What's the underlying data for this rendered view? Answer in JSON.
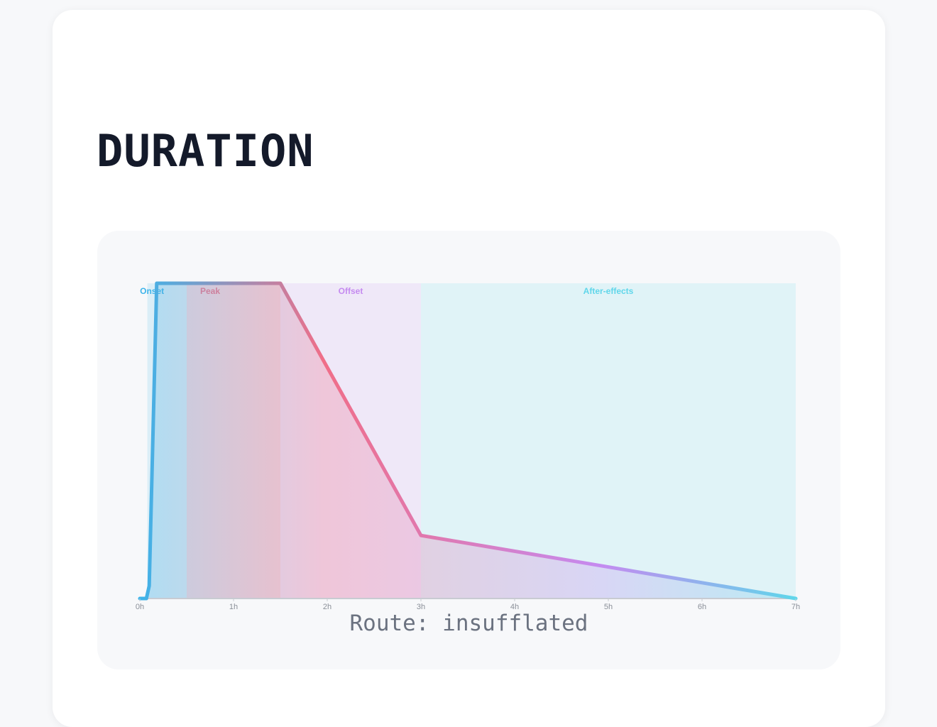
{
  "section": {
    "title": "DURATION"
  },
  "route_text": "Route: insufflated",
  "chart_data": {
    "type": "area",
    "x_unit": "h",
    "xlim": [
      0,
      7
    ],
    "ylim": [
      0,
      1
    ],
    "x_ticks": [
      "0h",
      "1h",
      "2h",
      "3h",
      "4h",
      "5h",
      "6h",
      "7h"
    ],
    "grid": false,
    "phases": [
      {
        "label": "Onset",
        "color": "#3db4ea",
        "start": 0.08,
        "end": 0.5
      },
      {
        "label": "Peak",
        "color": "#e9788f",
        "start": 0.5,
        "end": 1.5
      },
      {
        "label": "Offset",
        "color": "#c58af0",
        "start": 1.5,
        "end": 3.0
      },
      {
        "label": "After-effects",
        "color": "#5fd6ea",
        "start": 3.0,
        "end": 7.0
      }
    ],
    "series": [
      {
        "x": [
          0,
          0.07,
          0.1,
          0.18,
          1.5,
          3.0,
          7.0
        ],
        "y": [
          0,
          0,
          0.04,
          1.0,
          1.0,
          0.2,
          0
        ]
      }
    ],
    "gradient_colors": [
      "#3db4ea",
      "#f06e88",
      "#c58af0",
      "#5fd6ea"
    ]
  }
}
